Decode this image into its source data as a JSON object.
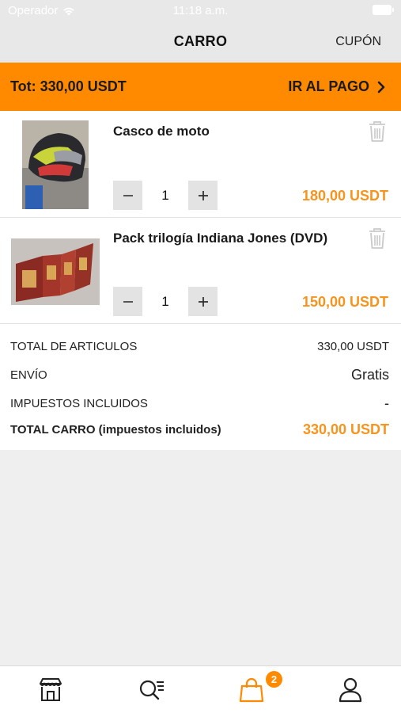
{
  "status_bar": {
    "carrier": "Operador",
    "time": "11:18 a.m."
  },
  "nav": {
    "title": "CARRO",
    "coupon_label": "CUPÓN"
  },
  "pay_bar": {
    "total_label": "Tot: 330,00 USDT",
    "checkout_label": "IR AL PAGO"
  },
  "items": [
    {
      "name": "Casco de moto",
      "quantity": "1",
      "price": "180,00 USDT"
    },
    {
      "name": "Pack trilogía Indiana Jones (DVD)",
      "quantity": "1",
      "price": "150,00 USDT"
    }
  ],
  "summary": {
    "articles_label": "TOTAL DE ARTICULOS",
    "articles_value": "330,00 USDT",
    "shipping_label": "ENVÍO",
    "shipping_value": "Gratis",
    "taxes_label": "IMPUESTOS INCLUIDOS",
    "taxes_value": "-",
    "total_label": "TOTAL CARRO (impuestos incluidos)",
    "total_value": "330,00 USDT"
  },
  "tab_bar": {
    "cart_badge": "2",
    "active_tab": "cart"
  },
  "colors": {
    "accent": "#ff8a00",
    "price": "#f7941d",
    "nav_bg": "#e8e8e8"
  },
  "icons": [
    "wifi-icon",
    "battery-icon",
    "chevron-right-icon",
    "trash-icon",
    "minus-icon",
    "plus-icon",
    "store-icon",
    "search-list-icon",
    "shopping-bag-icon",
    "user-icon"
  ]
}
